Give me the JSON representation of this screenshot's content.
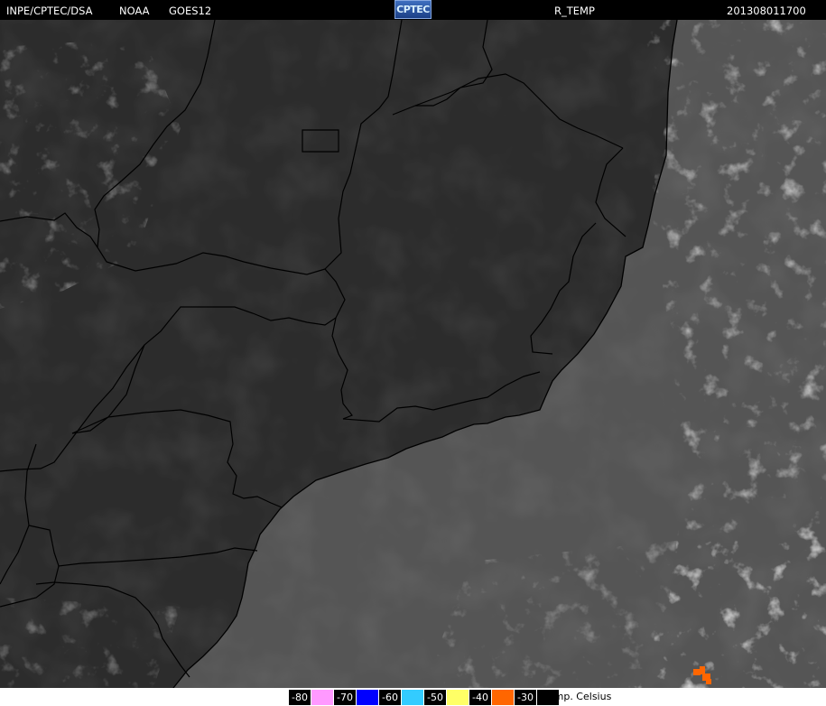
{
  "header": {
    "agency": "INPE/CPTEC/DSA",
    "provider": "NOAA",
    "satellite": "GOES12",
    "logo_text": "CPTEC",
    "product": "R_TEMP",
    "timestamp": "201308011700"
  },
  "legend": {
    "items": [
      {
        "label": "-80",
        "color": "#ff99ff"
      },
      {
        "label": "-70",
        "color": "#0000ff"
      },
      {
        "label": "-60",
        "color": "#33ccff"
      },
      {
        "label": "-50",
        "color": "#ffff66"
      },
      {
        "label": "-40",
        "color": "#ff6600"
      },
      {
        "label": "-30",
        "color": "#000000"
      }
    ],
    "unit": "Temp. Celsius"
  },
  "map": {
    "land_color": "#2c2c2c",
    "ocean_color": "#555555",
    "border_color": "#000000",
    "cloud_color": "#d0d0d0",
    "cold_top_color": "#ff6600"
  }
}
